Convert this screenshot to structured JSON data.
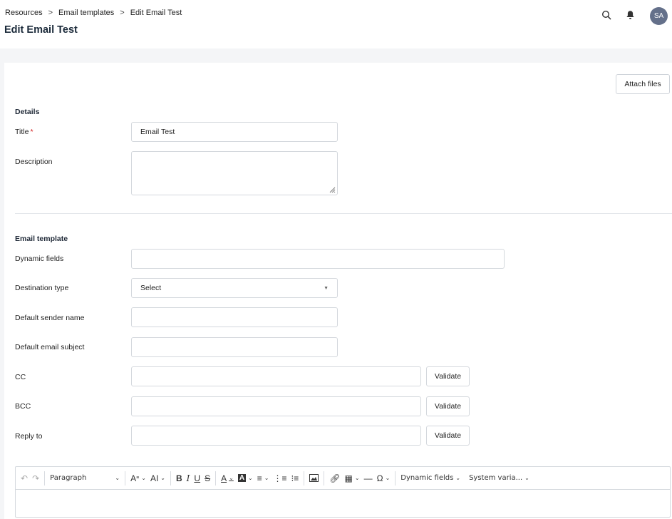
{
  "breadcrumb": {
    "items": [
      "Resources",
      "Email templates",
      "Edit Email Test"
    ],
    "separator": ">"
  },
  "page_title": "Edit Email Test",
  "user": {
    "initials": "SA"
  },
  "actions": {
    "attach_files": "Attach files"
  },
  "details": {
    "section_title": "Details",
    "title_label": "Title",
    "required_mark": "*",
    "title_value": "Email Test",
    "description_label": "Description",
    "description_value": ""
  },
  "email_template": {
    "section_title": "Email template",
    "dynamic_fields_label": "Dynamic fields",
    "destination_type_label": "Destination type",
    "destination_type_value": "Select",
    "sender_name_label": "Default sender name",
    "subject_label": "Default email subject",
    "cc_label": "CC",
    "bcc_label": "BCC",
    "reply_to_label": "Reply to",
    "validate_label": "Validate"
  },
  "editor": {
    "block_format": "Paragraph",
    "dynamic_fields": "Dynamic fields",
    "system_variables": "System varia..."
  },
  "colors": {
    "avatar_bg": "#64708a",
    "required": "#d21f1f",
    "page_bg": "#f4f5f7"
  }
}
